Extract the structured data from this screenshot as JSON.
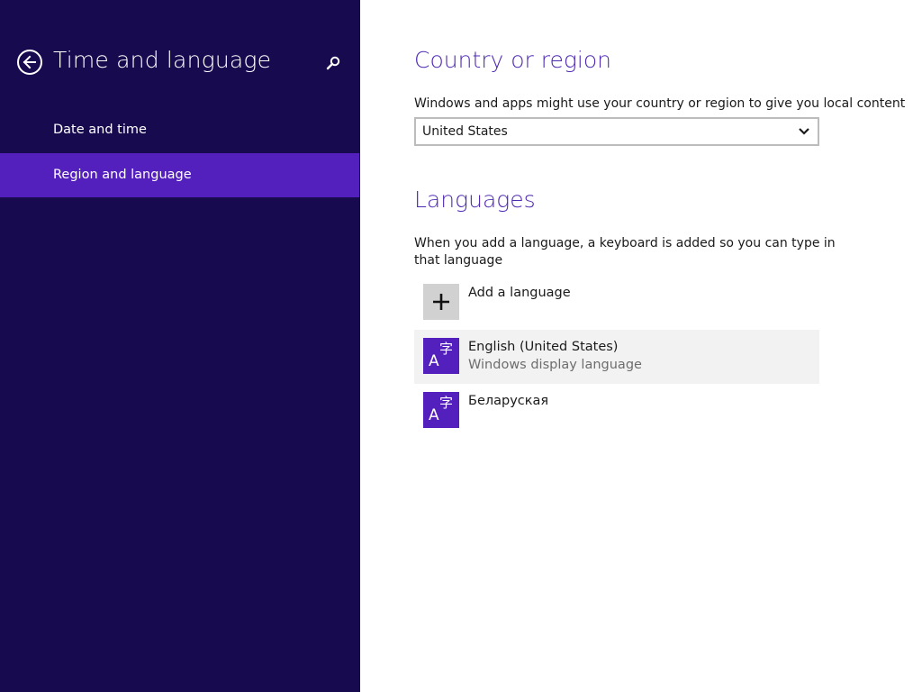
{
  "nav": {
    "title": "Time and language",
    "items": [
      {
        "label": "Date and time",
        "selected": false
      },
      {
        "label": "Region and language",
        "selected": true
      }
    ]
  },
  "country": {
    "heading": "Country or region",
    "description": "Windows and apps might use your country or region to give you local content",
    "selected_value": "United States"
  },
  "languages": {
    "heading": "Languages",
    "description": "When you add a language, a keyboard is added so you can type in that language",
    "add_label": "Add a language",
    "items": [
      {
        "name": "English (United States)",
        "subtitle": "Windows display language",
        "icon_glyph_latin": "A",
        "icon_glyph_cjk": "字"
      },
      {
        "name": "Беларуская",
        "subtitle": "",
        "icon_glyph_latin": "A",
        "icon_glyph_cjk": "字"
      }
    ]
  },
  "icons": {
    "back": "back-arrow-icon",
    "search": "search-icon",
    "dropdown": "chevron-down-icon",
    "add": "plus-icon",
    "language": "language-icon"
  },
  "colors": {
    "nav_background": "#180a4e",
    "nav_selected": "#5420bd",
    "accent_heading": "#4f2ab3",
    "language_tile": "#5420bd",
    "add_tile": "#d1d1d1",
    "selected_row": "#f2f2f2"
  }
}
